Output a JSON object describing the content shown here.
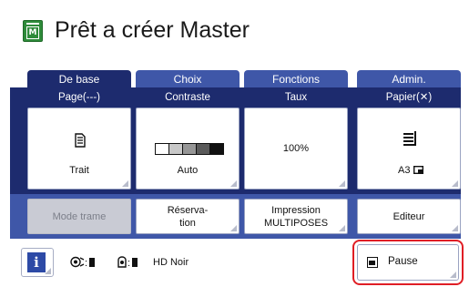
{
  "title": "Prêt a créer Master",
  "tabs": [
    {
      "label": "De base",
      "active": true
    },
    {
      "label": "Choix",
      "active": false
    },
    {
      "label": "Fonctions",
      "active": false
    },
    {
      "label": "Admin.",
      "active": false
    }
  ],
  "columns": [
    {
      "header": "Page(---)",
      "value": "Trait",
      "icon": "document-lines-icon"
    },
    {
      "header": "Contraste",
      "value": "Auto",
      "icon": "contrast-scale-icon"
    },
    {
      "header": "Taux",
      "value": "100%"
    },
    {
      "header": "Papier(✕)",
      "value": "A3",
      "icon": "paper-stack-icon"
    }
  ],
  "secondary": [
    {
      "label": "Mode trame",
      "enabled": false
    },
    {
      "label": "Réserva-\ntion",
      "enabled": true
    },
    {
      "label": "Impression\nMULTIPOSES",
      "enabled": true
    },
    {
      "label": "Editeur",
      "enabled": true
    }
  ],
  "status": {
    "ink_sep": ":",
    "master_sep": ":",
    "drum_label": "HD Noir",
    "info_symbol": "i"
  },
  "pause": {
    "label": "Pause"
  },
  "colors": {
    "tab_active": "#1d2b6e",
    "tab_inactive": "#3f57a8",
    "title_icon": "#2e8b3a",
    "highlight": "#e01e25"
  }
}
